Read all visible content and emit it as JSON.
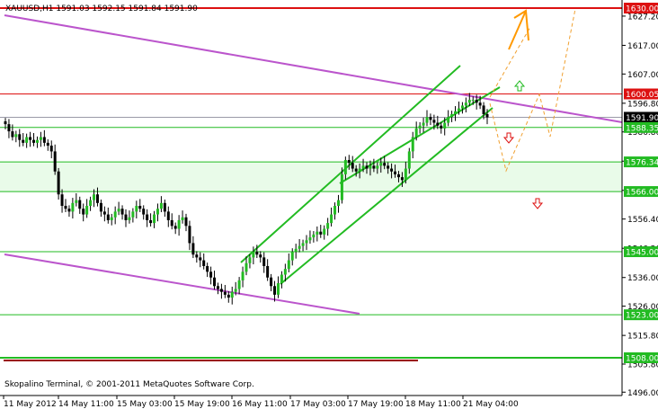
{
  "header": {
    "symbol_line": "XAUUSD,H1  1591.03  1592.15  1591.84  1591.90"
  },
  "footer": {
    "copyright": "Skopalino Terminal, © 2001-2011 MetaQuotes Software Corp."
  },
  "colors": {
    "green": "#22bb22",
    "red": "#dd1111",
    "purple": "#bb55cc",
    "orange": "#ff9900",
    "orange_dash": "#f0a030",
    "zone_fill": "#e9fbe9",
    "grey": "#9a9aa8",
    "axis": "#000000"
  },
  "chart_data": {
    "type": "candlestick",
    "title": "XAUUSD,H1",
    "ohlc_header": {
      "open": 1591.03,
      "high": 1592.15,
      "low": 1591.84,
      "close": 1591.9
    },
    "ylim": [
      1493,
      1632
    ],
    "price_ticks": [
      1627.2,
      1617.0,
      1607.0,
      1596.8,
      1586.8,
      1576.6,
      1566.4,
      1556.4,
      1546.2,
      1536.0,
      1526.0,
      1515.8,
      1505.8,
      1496.0
    ],
    "time_ticks": [
      "11 May 2012",
      "14 May 11:00",
      "15 May 03:00",
      "15 May 19:00",
      "16 May 11:00",
      "17 May 03:00",
      "17 May 19:00",
      "18 May 11:00",
      "21 May 04:00"
    ],
    "levels": [
      {
        "label": "1630.00",
        "value": 1630.0,
        "kind": "red"
      },
      {
        "label": "1600.05",
        "value": 1600.05,
        "kind": "red"
      },
      {
        "label": "1591.90",
        "value": 1591.9,
        "kind": "bid"
      },
      {
        "label": "1588.35",
        "value": 1588.35,
        "kind": "green"
      },
      {
        "label": "1576.34",
        "value": 1576.34,
        "kind": "green"
      },
      {
        "label": "1566.00",
        "value": 1566.0,
        "kind": "green"
      },
      {
        "label": "1545.00",
        "value": 1545.0,
        "kind": "green"
      },
      {
        "label": "1523.00",
        "value": 1523.0,
        "kind": "green"
      },
      {
        "label": "1508.00",
        "value": 1508.0,
        "kind": "green"
      }
    ],
    "support_zone": [
      1566.0,
      1576.34
    ],
    "candles_close": [
      1589.5,
      1587,
      1585,
      1586,
      1584,
      1583,
      1585,
      1584,
      1583,
      1584,
      1585,
      1583,
      1582,
      1580,
      1573,
      1565,
      1561,
      1560,
      1559,
      1562,
      1563,
      1560,
      1558,
      1561,
      1563,
      1565,
      1562,
      1559,
      1558,
      1556,
      1557,
      1559,
      1560,
      1558,
      1556,
      1557,
      1559,
      1561,
      1560,
      1558,
      1556,
      1555,
      1558,
      1560,
      1562,
      1559,
      1556,
      1554,
      1553,
      1556,
      1557,
      1554,
      1548,
      1544,
      1543,
      1542,
      1540,
      1538,
      1536,
      1533,
      1532,
      1531,
      1530,
      1529,
      1531,
      1532,
      1535,
      1538,
      1541,
      1543,
      1545,
      1544,
      1543,
      1540,
      1536,
      1533,
      1530,
      1534,
      1537,
      1539,
      1542,
      1545,
      1546,
      1547,
      1548,
      1549,
      1550,
      1551,
      1552,
      1551,
      1553,
      1555,
      1558,
      1561,
      1563,
      1572,
      1577,
      1576,
      1574,
      1573,
      1574,
      1575,
      1574,
      1575,
      1574,
      1575,
      1576,
      1575,
      1574,
      1573,
      1572,
      1571,
      1570,
      1574,
      1580,
      1585,
      1588,
      1589,
      1590,
      1592,
      1591,
      1590,
      1589,
      1588,
      1590,
      1592,
      1593,
      1594,
      1595,
      1596,
      1597,
      1598,
      1598,
      1597,
      1596,
      1593,
      1591.9
    ],
    "annotations": [
      "up arrow at 1603",
      "down arrow at 1585",
      "down arrow at 1563",
      "projected path to 1630.00"
    ]
  }
}
